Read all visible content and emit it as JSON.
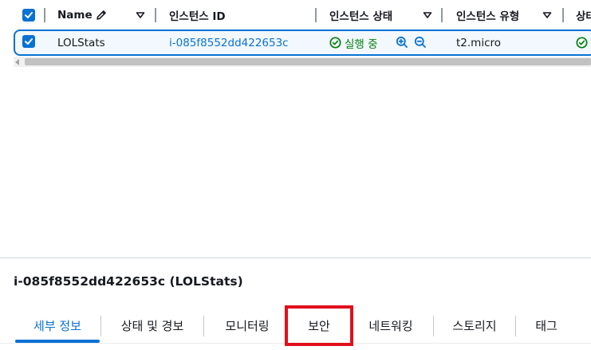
{
  "table": {
    "columns": [
      {
        "key": "name",
        "label": "Name"
      },
      {
        "key": "instance_id",
        "label": "인스턴스 ID"
      },
      {
        "key": "instance_state",
        "label": "인스턴스 상태"
      },
      {
        "key": "instance_type",
        "label": "인스턴스 유형"
      },
      {
        "key": "status_check",
        "label": "상태"
      }
    ],
    "rows": [
      {
        "selected": true,
        "name": "LOLStats",
        "instance_id": "i-085f8552dd422653c",
        "instance_state": "실행 중",
        "instance_type": "t2.micro"
      }
    ]
  },
  "details": {
    "title": "i-085f8552dd422653c (LOLStats)",
    "tabs": [
      {
        "label": "세부 정보",
        "active": true
      },
      {
        "label": "상태 및 경보",
        "active": false
      },
      {
        "label": "모니터링",
        "active": false
      },
      {
        "label": "보안",
        "active": false,
        "highlighted": true
      },
      {
        "label": "네트워킹",
        "active": false
      },
      {
        "label": "스토리지",
        "active": false
      },
      {
        "label": "태그",
        "active": false
      }
    ]
  },
  "colors": {
    "accent": "#0972d3",
    "success": "#037f0c",
    "highlight": "#e0101c"
  },
  "icons": [
    "checkbox-checked-icon",
    "edit-pencil-icon",
    "sort-caret-icon",
    "status-success-icon",
    "zoom-in-icon",
    "zoom-out-icon"
  ]
}
